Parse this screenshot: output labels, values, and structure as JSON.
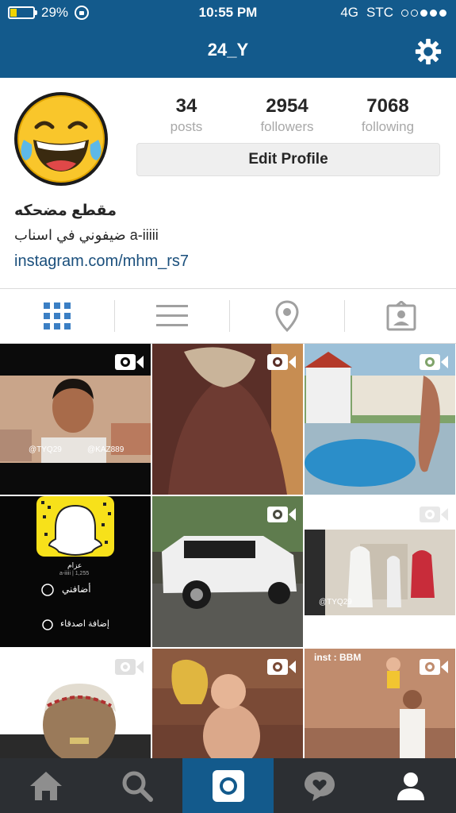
{
  "status_bar": {
    "battery_percent": "29%",
    "battery_level": 0.29,
    "time": "10:55 PM",
    "network": "4G",
    "carrier": "STC"
  },
  "nav": {
    "title": "24_Y",
    "settings_icon": "gear-icon"
  },
  "profile": {
    "avatar_icon": "laughing-emoji-avatar",
    "stats": [
      {
        "value": "34",
        "label": "posts"
      },
      {
        "value": "2954",
        "label": "followers"
      },
      {
        "value": "7068",
        "label": "following"
      }
    ],
    "edit_button": "Edit Profile",
    "full_name": "مقطع مضحكه",
    "bio": "ضيفوني في اسناب a-iiiii",
    "link": "instagram.com/mhm_rs7"
  },
  "tabs": [
    {
      "icon": "grid-view-icon",
      "active": true
    },
    {
      "icon": "list-view-icon",
      "active": false
    },
    {
      "icon": "location-pin-icon",
      "active": false
    },
    {
      "icon": "tagged-photos-icon",
      "active": false
    }
  ],
  "posts": [
    {
      "type": "video",
      "overlay_text": [
        "@TYQ29",
        "@KAZ889"
      ]
    },
    {
      "type": "video",
      "overlay_text": []
    },
    {
      "type": "video",
      "overlay_text": []
    },
    {
      "type": "photo",
      "overlay_text": [
        "عزام",
        "a-iiiii | 1,255",
        "أضافني",
        "إضافة اصدقاء"
      ]
    },
    {
      "type": "video",
      "overlay_text": []
    },
    {
      "type": "video",
      "overlay_text": [
        "@TYQ29"
      ]
    },
    {
      "type": "video",
      "overlay_text": []
    },
    {
      "type": "video",
      "overlay_text": []
    },
    {
      "type": "video",
      "overlay_text": [
        "inst : BBM"
      ]
    }
  ],
  "bottom_nav": [
    {
      "icon": "home-icon",
      "active": false
    },
    {
      "icon": "search-icon",
      "active": false
    },
    {
      "icon": "camera-icon",
      "active": true
    },
    {
      "icon": "activity-heart-icon",
      "active": false
    },
    {
      "icon": "profile-icon",
      "active": false
    }
  ],
  "colors": {
    "brand_blue": "#135a8c",
    "tab_active_blue": "#3b7fc4",
    "link_blue": "#1a4f7c",
    "bottom_bar": "#2c2f33",
    "battery_fill": "#f2d400"
  }
}
